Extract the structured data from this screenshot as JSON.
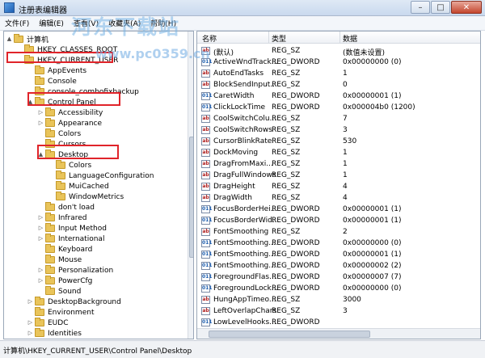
{
  "window": {
    "title": "注册表编辑器",
    "buttons": [
      "–",
      "□",
      "✕"
    ]
  },
  "menu": [
    "文件(F)",
    "编辑(E)",
    "查看(V)",
    "收藏夹(A)",
    "帮助(H)"
  ],
  "watermark": {
    "brand": "河东下载站",
    "url": "www.pc0359.cn"
  },
  "tree": [
    {
      "label": "计算机",
      "indent": 0,
      "expander": "▲"
    },
    {
      "label": "HKEY_CLASSES_ROOT",
      "indent": 1,
      "expander": ""
    },
    {
      "label": "HKEY_CURRENT_USER",
      "indent": 1,
      "expander": ""
    },
    {
      "label": "AppEvents",
      "indent": 2,
      "expander": ""
    },
    {
      "label": "Console",
      "indent": 2,
      "expander": ""
    },
    {
      "label": "console_combofixbackup",
      "indent": 2,
      "expander": ""
    },
    {
      "label": "Control Panel",
      "indent": 2,
      "expander": "▲"
    },
    {
      "label": "Accessibility",
      "indent": 3,
      "expander": "▷"
    },
    {
      "label": "Appearance",
      "indent": 3,
      "expander": "▷"
    },
    {
      "label": "Colors",
      "indent": 3,
      "expander": ""
    },
    {
      "label": "Cursors",
      "indent": 3,
      "expander": ""
    },
    {
      "label": "Desktop",
      "indent": 3,
      "expander": "▲"
    },
    {
      "label": "Colors",
      "indent": 4,
      "expander": ""
    },
    {
      "label": "LanguageConfiguration",
      "indent": 4,
      "expander": ""
    },
    {
      "label": "MuiCached",
      "indent": 4,
      "expander": ""
    },
    {
      "label": "WindowMetrics",
      "indent": 4,
      "expander": ""
    },
    {
      "label": "don't load",
      "indent": 3,
      "expander": ""
    },
    {
      "label": "Infrared",
      "indent": 3,
      "expander": "▷"
    },
    {
      "label": "Input Method",
      "indent": 3,
      "expander": "▷"
    },
    {
      "label": "International",
      "indent": 3,
      "expander": "▷"
    },
    {
      "label": "Keyboard",
      "indent": 3,
      "expander": ""
    },
    {
      "label": "Mouse",
      "indent": 3,
      "expander": ""
    },
    {
      "label": "Personalization",
      "indent": 3,
      "expander": "▷"
    },
    {
      "label": "PowerCfg",
      "indent": 3,
      "expander": "▷"
    },
    {
      "label": "Sound",
      "indent": 3,
      "expander": ""
    },
    {
      "label": "DesktopBackground",
      "indent": 2,
      "expander": "▷"
    },
    {
      "label": "Environment",
      "indent": 2,
      "expander": ""
    },
    {
      "label": "EUDC",
      "indent": 2,
      "expander": "▷"
    },
    {
      "label": "Identities",
      "indent": 2,
      "expander": "▷"
    }
  ],
  "columns": [
    "名称",
    "类型",
    "数据"
  ],
  "values": [
    {
      "name": "(默认)",
      "type": "REG_SZ",
      "data": "(数值未设置)",
      "icon": "ab"
    },
    {
      "name": "ActiveWndTrack...",
      "type": "REG_DWORD",
      "data": "0x00000000 (0)",
      "icon": "dw"
    },
    {
      "name": "AutoEndTasks",
      "type": "REG_SZ",
      "data": "1",
      "icon": "ab"
    },
    {
      "name": "BlockSendInput...",
      "type": "REG_SZ",
      "data": "0",
      "icon": "ab"
    },
    {
      "name": "CaretWidth",
      "type": "REG_DWORD",
      "data": "0x00000001 (1)",
      "icon": "dw"
    },
    {
      "name": "ClickLockTime",
      "type": "REG_DWORD",
      "data": "0x000004b0 (1200)",
      "icon": "dw"
    },
    {
      "name": "CoolSwitchColu...",
      "type": "REG_SZ",
      "data": "7",
      "icon": "ab"
    },
    {
      "name": "CoolSwitchRows",
      "type": "REG_SZ",
      "data": "3",
      "icon": "ab"
    },
    {
      "name": "CursorBlinkRate",
      "type": "REG_SZ",
      "data": "530",
      "icon": "ab"
    },
    {
      "name": "DockMoving",
      "type": "REG_SZ",
      "data": "1",
      "icon": "ab"
    },
    {
      "name": "DragFromMaxi...",
      "type": "REG_SZ",
      "data": "1",
      "icon": "ab"
    },
    {
      "name": "DragFullWindows",
      "type": "REG_SZ",
      "data": "1",
      "icon": "ab"
    },
    {
      "name": "DragHeight",
      "type": "REG_SZ",
      "data": "4",
      "icon": "ab"
    },
    {
      "name": "DragWidth",
      "type": "REG_SZ",
      "data": "4",
      "icon": "ab"
    },
    {
      "name": "FocusBorderHei...",
      "type": "REG_DWORD",
      "data": "0x00000001 (1)",
      "icon": "dw"
    },
    {
      "name": "FocusBorderWid...",
      "type": "REG_DWORD",
      "data": "0x00000001 (1)",
      "icon": "dw"
    },
    {
      "name": "FontSmoothing",
      "type": "REG_SZ",
      "data": "2",
      "icon": "ab"
    },
    {
      "name": "FontSmoothing...",
      "type": "REG_DWORD",
      "data": "0x00000000 (0)",
      "icon": "dw"
    },
    {
      "name": "FontSmoothing...",
      "type": "REG_DWORD",
      "data": "0x00000001 (1)",
      "icon": "dw"
    },
    {
      "name": "FontSmoothing...",
      "type": "REG_DWORD",
      "data": "0x00000002 (2)",
      "icon": "dw"
    },
    {
      "name": "ForegroundFlas...",
      "type": "REG_DWORD",
      "data": "0x00000007 (7)",
      "icon": "dw"
    },
    {
      "name": "ForegroundLock...",
      "type": "REG_DWORD",
      "data": "0x00000000 (0)",
      "icon": "dw"
    },
    {
      "name": "HungAppTimeo...",
      "type": "REG_SZ",
      "data": "3000",
      "icon": "ab"
    },
    {
      "name": "LeftOverlapChars",
      "type": "REG_SZ",
      "data": "3",
      "icon": "ab"
    },
    {
      "name": "LowLevelHooks...",
      "type": "REG_DWORD",
      "data": "",
      "icon": "dw"
    }
  ],
  "status": "计算机\\HKEY_CURRENT_USER\\Control Panel\\Desktop"
}
